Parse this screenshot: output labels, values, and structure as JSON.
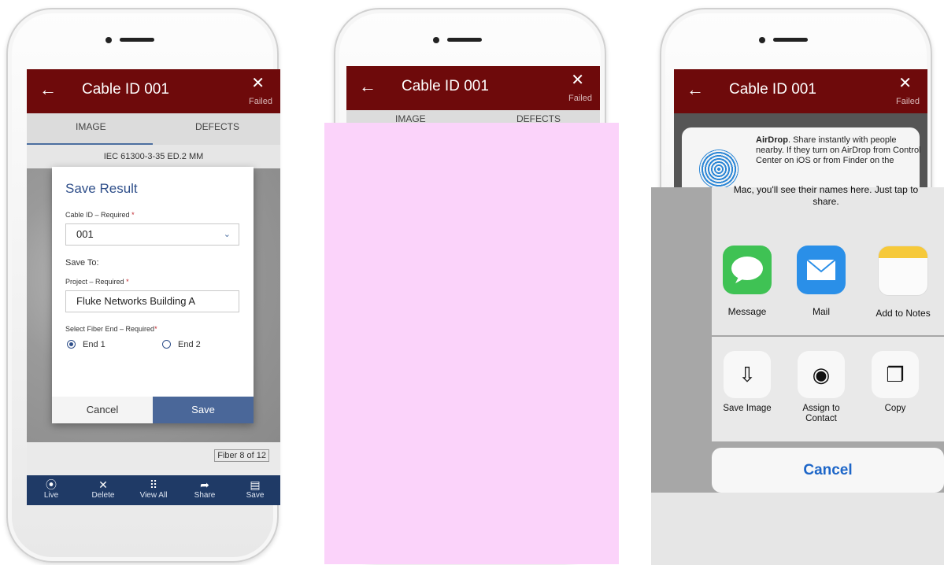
{
  "phone1": {
    "appbar": {
      "title": "Cable ID 001",
      "status": "Failed"
    },
    "tabs": [
      "IMAGE",
      "DEFECTS"
    ],
    "image_label": "IEC 61300-3-35 ED.2 MM",
    "dialog": {
      "title": "Save Result",
      "cable_id_label": "Cable ID – Required",
      "cable_id_value": "001",
      "save_to_label": "Save To:",
      "project_label": "Project – Required",
      "project_value": "Fluke Networks Building A",
      "fiber_end_label": "Select Fiber End – Required",
      "required_mark": "*",
      "end1_label": "End 1",
      "end2_label": "End 2",
      "cancel_label": "Cancel",
      "save_label": "Save"
    },
    "fiber_count": "Fiber 8 of 12",
    "bottom_nav": [
      {
        "icon": "play-circle-icon",
        "label": "Live"
      },
      {
        "icon": "close-icon",
        "label": "Delete"
      },
      {
        "icon": "grid-icon",
        "label": "View All"
      },
      {
        "icon": "share-arrow-icon",
        "label": "Share"
      },
      {
        "icon": "floppy-disk-icon",
        "label": "Save"
      }
    ]
  },
  "phone2": {
    "appbar": {
      "title": "Cable ID 001",
      "status": "Failed"
    },
    "tabs": [
      "IMAGE",
      "DEFECTS"
    ]
  },
  "phone3": {
    "appbar": {
      "title": "Cable ID 001",
      "status": "Failed"
    },
    "airdrop_bold": "AirDrop",
    "airdrop_text": ". Share instantly with people nearby. If they turn on AirDrop from Control Center on iOS or from Finder on the",
    "airdrop_text_2": "Mac, you'll see their names here. Just tap to share.",
    "apps": [
      {
        "icon": "message-icon",
        "label": "Message"
      },
      {
        "icon": "mail-icon",
        "label": "Mail"
      },
      {
        "icon": "notes-icon",
        "label": "Add to Notes"
      }
    ],
    "actions": [
      {
        "icon": "save-image-icon",
        "label": "Save Image"
      },
      {
        "icon": "assign-contact-icon",
        "label": "Assign to Contact"
      },
      {
        "icon": "copy-icon",
        "label": "Copy"
      }
    ],
    "cancel_label": "Cancel"
  },
  "colors": {
    "appbar": "#6e0a0b",
    "bottom_nav": "#1f3a66",
    "dialog_accent": "#4a6799",
    "ios_blue": "#1d66c8",
    "overlay": "#fbd3fa"
  }
}
